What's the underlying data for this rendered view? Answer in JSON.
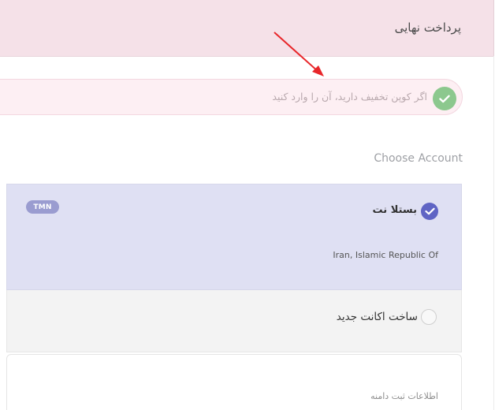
{
  "header": {
    "title": "پرداخت نهایی"
  },
  "coupon": {
    "prompt": "اگر کوپن تخفیف دارید، آن را وارد کنید",
    "icon": "check-circle-icon"
  },
  "accounts": {
    "section_label": "Choose Account",
    "selected": {
      "name": "بستلا نت",
      "country": "Iran, Islamic Republic Of",
      "currency_badge": "TMN",
      "icon": "check-circle-icon"
    },
    "create_new": {
      "label": "ساخت اکانت جدید"
    }
  },
  "domain": {
    "section_label": "اطلاعات ثبت دامنه"
  },
  "colors": {
    "header_bg": "#f5e1e8",
    "coupon_check": "#8cc88e",
    "selected_bg": "#dfe0f3",
    "accent": "#5f64c4",
    "annotation_arrow": "#e8262a"
  }
}
